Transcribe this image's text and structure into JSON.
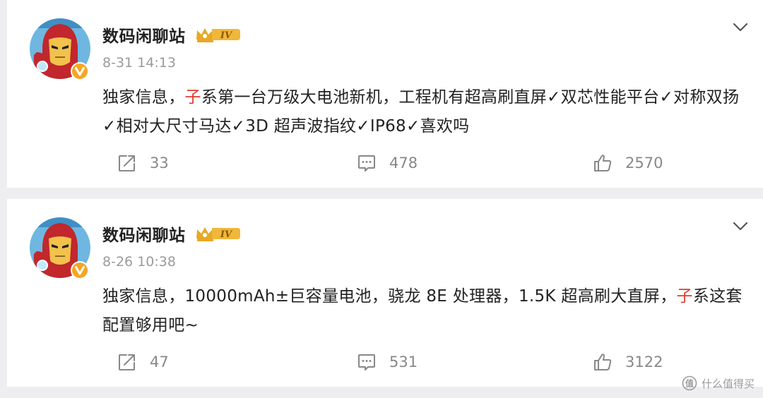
{
  "posts": [
    {
      "author": "数码闲聊站",
      "rank_badge": "IV",
      "time": "8-31 14:13",
      "text_parts": [
        "独家信息，",
        "子",
        "系第一台万级大电池新机，工程机有超高刷直屏✓双芯性能平台✓对称双扬✓相对大尺寸马达✓3D 超声波指纹✓IP68✓喜欢吗"
      ],
      "reposts": "33",
      "comments": "478",
      "likes": "2570"
    },
    {
      "author": "数码闲聊站",
      "rank_badge": "IV",
      "time": "8-26 10:38",
      "text_parts": [
        "独家信息，10000mAh±巨容量电池，骁龙 8E 处理器，1.5K 超高刷大直屏，",
        "子",
        "系这套配置够用吧~"
      ],
      "reposts": "47",
      "comments": "531",
      "likes": "3122"
    }
  ],
  "icons": {
    "repost": "repost-icon",
    "comment": "comment-icon",
    "like": "thumbs-up-icon",
    "more": "chevron-down-icon",
    "verified": "verified-v-badge-icon",
    "rank": "crown-rank-badge-icon"
  },
  "colors": {
    "highlight": "#e03a2f",
    "username": "#222222",
    "meta": "#9a9a9a",
    "rank_badge": "#e8a825",
    "verified_badge": "#f5a623"
  },
  "watermark": {
    "text": "什么值得买"
  }
}
